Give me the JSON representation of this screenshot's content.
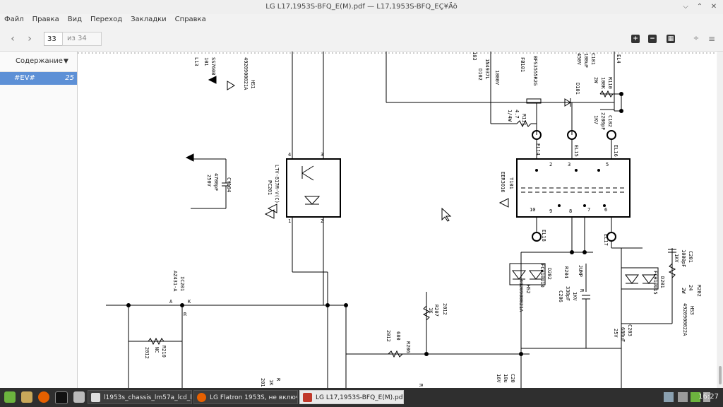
{
  "window": {
    "title": "LG L17,1953S-BFQ_E(M).pdf — L17,1953S-BFQ_EÇ¥Äö"
  },
  "menu": [
    "Файл",
    "Правка",
    "Вид",
    "Переход",
    "Закладки",
    "Справка"
  ],
  "toolbar": {
    "page_value": "33",
    "page_total": "из 34"
  },
  "sidebar": {
    "header": "Содержание",
    "items": [
      {
        "label": "#EV#",
        "page": "25"
      }
    ]
  },
  "schematic": {
    "labels": {
      "l13": "L13",
      "l101": "101",
      "ss": "SS760B",
      "hs1_part": "4920900021A",
      "hs1": "HS1",
      "cy104": "CY104",
      "cy104_val": "4700pF",
      "cy104_v": "250V",
      "pc201": "PC201",
      "pc_part": "LTV-817M-V(C)",
      "pin4": "4",
      "pin3": "3",
      "pin1": "1",
      "pin2": "2",
      "ic201": "IC201",
      "ic201_part": "AZ431-A",
      "ka": "K",
      "aa": "A",
      "rr": "R",
      "r210": "R210",
      "nc": "NC",
      "r210_val": "2012",
      "r207": "R207",
      "r207_val": "1K",
      "r207_sz": "2012",
      "r206": "R206",
      "r206_val": "680",
      "r206_sz": "2012",
      "bot1": "1K",
      "bot2": "201",
      "bot3": "R",
      "bot4": "R",
      "d102": "D102",
      "d102_part": "1N4937L",
      "d102_v": "1000V",
      "d103": "103",
      "fb101": "FB101",
      "fb_part": "BFS3555R2G",
      "d101": "D101",
      "r111": "R111",
      "r111_val": "4.7",
      "r111_w": "1/4W",
      "el4": "EL4",
      "c101": "C101",
      "c101_v1": "100uF",
      "c101_v2": "450V",
      "r110": "R110",
      "r110_val": "100K",
      "r110_w": "2W",
      "c102": "C102",
      "c102_val": "2200pF",
      "c102_v": "1KV",
      "el14": "EL14",
      "el15": "EL15",
      "el16": "EL16",
      "t101": "T101",
      "t101_part": "EER3016",
      "p2": "2",
      "p3": "3",
      "p5": "5",
      "p10": "10",
      "p9": "9",
      "p8": "8",
      "p7": "7",
      "p6": "6",
      "el18": "EL18",
      "el17": "EL17",
      "d202": "D202",
      "d202_part": "FCH10U10",
      "hs2": "HS2",
      "hs2_part": "4920900021A",
      "r204": "R204",
      "jump": "JUMP",
      "c206": "C206",
      "c206_val": "330pF",
      "c206_v": "1KV",
      "c206_r": "R",
      "c201": "C201",
      "c201_val": "1000pF",
      "c201_v": "1KV",
      "d201": "D201",
      "d201_part": "FCH10U15",
      "r202": "R202",
      "r202_val": "24",
      "r202_w": "2W",
      "hs3": "HS3",
      "hs3_part": "4920900022A",
      "c203": "C203",
      "c203_val": "680uF",
      "c203_v": "25V",
      "c20x": "C20",
      "c20x_v1": "10u",
      "c20x_v2": "16V"
    }
  },
  "taskbar": {
    "tasks": [
      {
        "label": "l1953s_chassis_lm57a_lcd_lg..."
      },
      {
        "label": "LG Flatron 1953S, не включ..."
      },
      {
        "label": "LG L17,1953S-BFQ_E(M).pdf ..."
      }
    ],
    "clock": "16:27"
  }
}
